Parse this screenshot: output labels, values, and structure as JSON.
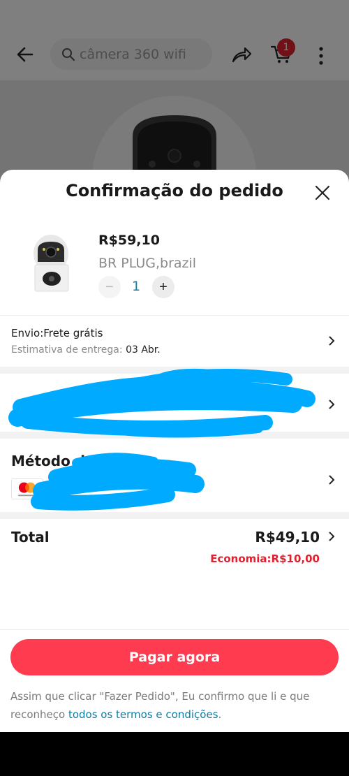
{
  "header": {
    "search_placeholder": "câmera 360 wifi",
    "cart_count": "1"
  },
  "sheet": {
    "title": "Confirmação do pedido"
  },
  "product": {
    "price": "R$59,10",
    "variant": "BR PLUG,brazil",
    "quantity": "1",
    "minus": "−",
    "plus": "+"
  },
  "shipping": {
    "title": "Envio:Frete grátis",
    "estimate_label": "Estimativa de entrega: ",
    "estimate_date": "03 Abr."
  },
  "payment": {
    "title": "Método d"
  },
  "summary": {
    "total_label": "Total",
    "total_value": "R$49,10",
    "savings": "Economia:R$10,00"
  },
  "actions": {
    "pay_label": "Pagar agora",
    "terms_text": "Assim que clicar \"Fazer Pedido\", Eu confirmo que li e que reconheço ",
    "terms_link": "todos os termos e condições",
    "terms_end": "."
  },
  "colors": {
    "accent": "#ff3b4f",
    "link": "#0a7fa8",
    "savings": "#e0202e",
    "scribble": "#00aaff"
  }
}
